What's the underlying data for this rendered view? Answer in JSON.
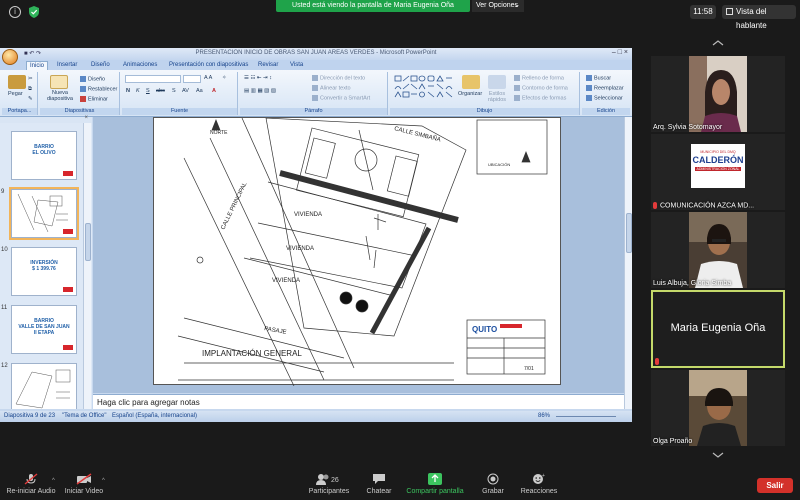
{
  "topbar": {
    "share_banner": "Usted está viendo la pantalla de Maria Eugenia Oña",
    "view_options": "Ver Opciones",
    "clock": "11:58",
    "speaker_view": "Vista del hablante"
  },
  "ppt": {
    "window_title": "PRESENTACION INICIO DE OBRAS SAN JUAN AREAS VERDES - Microsoft PowerPoint",
    "tabs": [
      "Inicio",
      "Insertar",
      "Diseño",
      "Animaciones",
      "Presentación con diapositivas",
      "Revisar",
      "Vista"
    ],
    "ribbon": {
      "pegar": "Pegar",
      "portapapeles": "Portapa...",
      "nueva_diapositiva": "Nueva diapositiva",
      "diseno": "Diseño",
      "restablecer": "Restablecer",
      "eliminar": "Eliminar",
      "diapositivas": "Diapositivas",
      "fuente": "Fuente",
      "direccion_texto": "Dirección del texto",
      "alinear_texto": "Alinear texto",
      "convertir_smartart": "Convertir a SmartArt",
      "parrafo": "Párrafo",
      "organizar": "Organizar",
      "estilos_rapidos": "Estilos rápidos",
      "relleno_forma": "Relleno de forma",
      "contorno_forma": "Contorno de forma",
      "efectos_formas": "Efectos de formas",
      "dibujo": "Dibujo",
      "buscar": "Buscar",
      "reemplazar": "Reemplazar",
      "seleccionar": "Seleccionar",
      "edicion": "Edición"
    },
    "slides": [
      {
        "num": "",
        "text": "BARRIO\nEL OLIVO"
      },
      {
        "num": "9",
        "text": ""
      },
      {
        "num": "10",
        "text": "INVERSIÓN\n$ 1 399.76"
      },
      {
        "num": "11",
        "text": "BARRIO\nVALLE DE SAN JUAN\nII ETAPA"
      },
      {
        "num": "12",
        "text": ""
      }
    ],
    "slide_content": {
      "calle_principal": "CALLE PRINCIPAL",
      "norte": "NORTE",
      "simbaña": "CALLE SIMBAÑA",
      "vivienda": "VIVIENDA",
      "pasaje": "PASAJE",
      "implantacion": "IMPLANTACIÓN GENERAL",
      "ubicacion": "UBICACIÓN",
      "sheet_no": "7/01"
    },
    "notes_placeholder": "Haga clic para agregar notas",
    "status": {
      "slide_of": "Diapositiva 9 de 23",
      "theme": "\"Tema de Office\"",
      "language": "Español (España, internacional)",
      "zoom": "86%"
    }
  },
  "participants": [
    {
      "name": "Arq. Sylvia Sotomayor",
      "muted": false
    },
    {
      "name": "COMUNICACIÓN AZCA MD...",
      "muted": true,
      "logo_top": "MUNICIPIO DEL DMQ",
      "logo_main": "CALDERÓN",
      "logo_sub": "ADMINISTRACIÓN ZONAL"
    },
    {
      "name": "Luis Albuja, Gloria Simba",
      "muted": false
    },
    {
      "name": "Maria Eugenia Oña",
      "muted": true,
      "active_speaker": true
    },
    {
      "name": "Olga Proaño",
      "muted": false
    }
  ],
  "bottombar": {
    "audio": "Re-iniciar Audio",
    "video": "Iniciar Video",
    "participants": "Participantes",
    "participants_count": "26",
    "chat": "Chatear",
    "share": "Compartir pantalla",
    "record": "Grabar",
    "reactions": "Reacciones",
    "leave": "Salir"
  }
}
